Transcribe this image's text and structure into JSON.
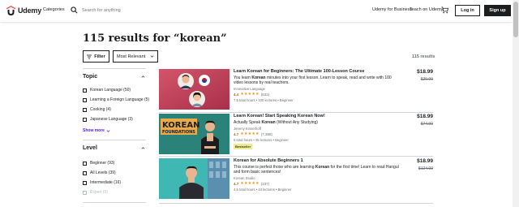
{
  "header": {
    "logo_text": "Udemy",
    "categories": "Categories",
    "search_placeholder": "Search for anything",
    "business": "Udemy for Business",
    "teach": "Teach on Udemy",
    "login": "Log in",
    "signup": "Sign up"
  },
  "results_title": "115 results for “korean”",
  "filter_label": "Filter",
  "sort_label": "Most Relevant",
  "results_count": "115 results",
  "sidebar": {
    "topic": {
      "heading": "Topic",
      "options": [
        {
          "label": "Korean Language",
          "count": "(50)"
        },
        {
          "label": "Learning a Foreign Language",
          "count": "(5)"
        },
        {
          "label": "Cooking",
          "count": "(4)"
        },
        {
          "label": "Japanese Language",
          "count": "(3)"
        }
      ],
      "show_more": "Show more"
    },
    "level": {
      "heading": "Level",
      "options": [
        {
          "label": "Beginner",
          "count": "(93)"
        },
        {
          "label": "All Levels",
          "count": "(39)"
        },
        {
          "label": "Intermediate",
          "count": "(16)"
        },
        {
          "label": "Expert",
          "count": "(0)"
        }
      ]
    }
  },
  "courses": [
    {
      "title": "Learn Korean for Beginners: The Ultimate 100-Lesson Course",
      "desc_pre": "You learn ",
      "desc_kw": "Korean",
      "desc_post": " minutes into your first lesson. Learn to speak, read and write with 100 video lessons by real teachers.",
      "instructor": "Innovative Language",
      "rating": "4.4",
      "stars": "★★★★★",
      "reviews": "(832)",
      "meta": "7.5 total hours • 100 lectures • Beginner",
      "badge": "",
      "price": "$18.99",
      "old_price": "$29.99",
      "thumb_text": ""
    },
    {
      "title": "Learn Korean! Start Speaking Korean Now!",
      "desc_pre": "Actually Speak ",
      "desc_kw": "Korean",
      "desc_post": " (Without Any Studying)",
      "instructor": "Jeremy Kinnerhoff",
      "rating": "4.7",
      "stars": "★★★★★",
      "reviews": "(7,388)",
      "meta": "5 total hours • 45 lectures • Beginner",
      "badge": "Bestseller",
      "price": "$18.99",
      "old_price": "$74.99",
      "thumb_text": "KOREAN FOUNDATIONS"
    },
    {
      "title": "Korean for Absolute Beginners 1",
      "desc_pre": "This course is perfect those who are learning ",
      "desc_kw": "Korean",
      "desc_post": " for the first time! Learn to read Hangul and form basic sentences!",
      "instructor": "Korean Studio",
      "rating": "4.7",
      "stars": "★★★★★",
      "reviews": "(337)",
      "meta": "4.5 total hours • 44 lectures • Beginner",
      "badge": "",
      "price": "$18.99",
      "old_price": "$124.99",
      "thumb_text": ""
    }
  ],
  "colors": {
    "accent_purple": "#5624d0",
    "rating_orange": "#b4690e",
    "star": "#e59819",
    "logo_red": "#a435f0"
  }
}
